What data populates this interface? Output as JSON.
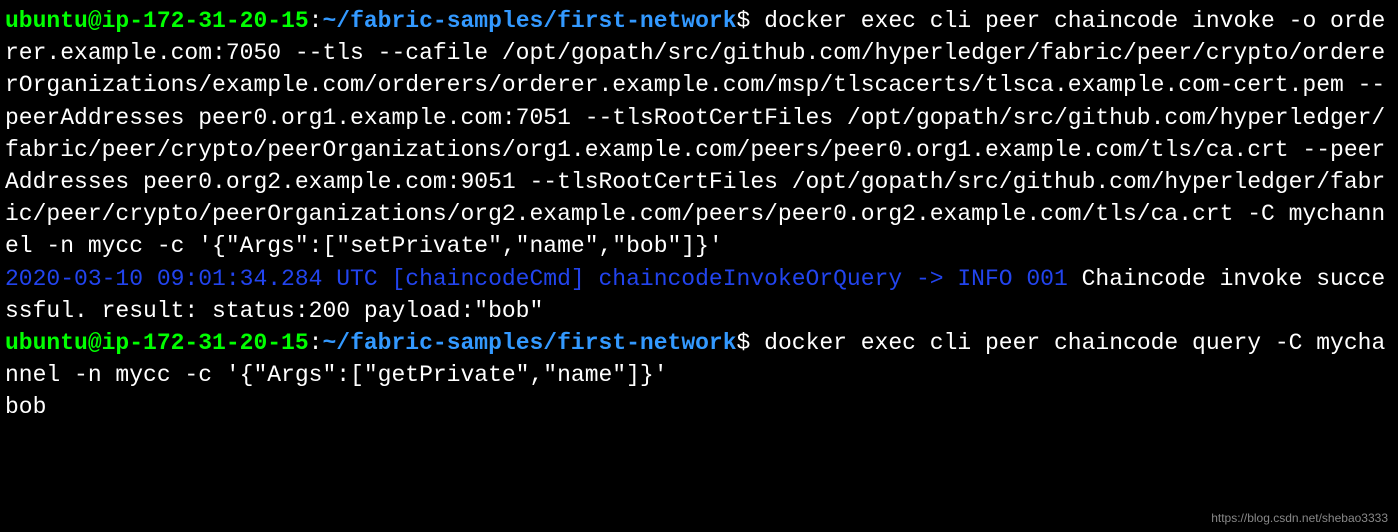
{
  "prompt1": {
    "userHost": "ubuntu@ip-172-31-20-15",
    "colon": ":",
    "path": "~/fabric-samples/first-network",
    "dollar": "$"
  },
  "command1": " docker exec cli peer chaincode invoke -o orderer.example.com:7050 --tls --cafile /opt/gopath/src/github.com/hyperledger/fabric/peer/crypto/ordererOrganizations/example.com/orderers/orderer.example.com/msp/tlscacerts/tlsca.example.com-cert.pem --peerAddresses peer0.org1.example.com:7051 --tlsRootCertFiles /opt/gopath/src/github.com/hyperledger/fabric/peer/crypto/peerOrganizations/org1.example.com/peers/peer0.org1.example.com/tls/ca.crt --peerAddresses peer0.org2.example.com:9051 --tlsRootCertFiles /opt/gopath/src/github.com/hyperledger/fabric/peer/crypto/peerOrganizations/org2.example.com/peers/peer0.org2.example.com/tls/ca.crt -C mychannel -n mycc -c '{\"Args\":[\"setPrivate\",\"name\",\"bob\"]}'",
  "log1": {
    "info": "2020-03-10 09:01:34.284 UTC [chaincodeCmd] chaincodeInvokeOrQuery -> INFO 001",
    "message": " Chaincode invoke successful. result: status:200 payload:\"bob\" "
  },
  "prompt2": {
    "userHost": "ubuntu@ip-172-31-20-15",
    "colon": ":",
    "path": "~/fabric-samples/first-network",
    "dollar": "$"
  },
  "command2": " docker exec cli peer chaincode query -C mychannel -n mycc -c '{\"Args\":[\"getPrivate\",\"name\"]}'",
  "output2": "bob",
  "watermark": "https://blog.csdn.net/shebao3333"
}
